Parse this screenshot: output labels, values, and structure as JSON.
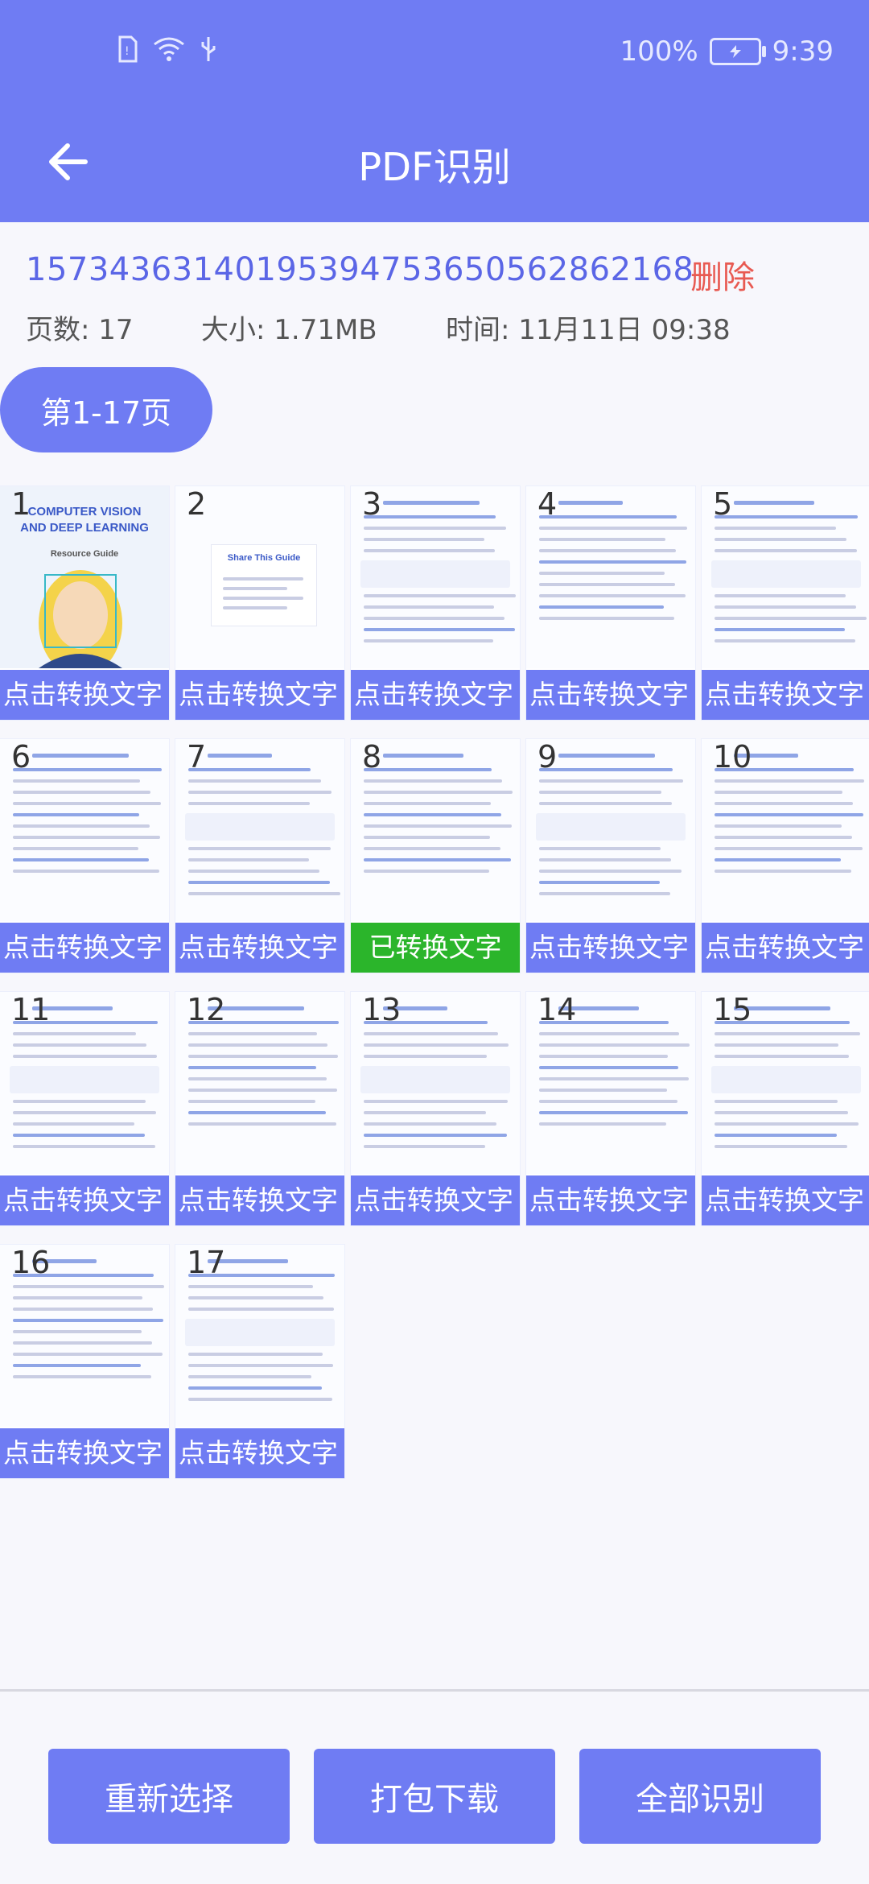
{
  "status_bar": {
    "battery": "100%",
    "time": "9:39"
  },
  "header": {
    "title": "PDF识别"
  },
  "document": {
    "name": "15734363140195394753650562862168",
    "delete_label": "删除",
    "pages_label": "页数: 17",
    "size_label": "大小: 1.71MB",
    "time_label": "时间: 11月11日 09:38"
  },
  "page_range": "第1-17页",
  "pages": [
    {
      "n": "1",
      "caption": "点击转换文字",
      "converted": false,
      "thumb_text": [
        "COMPUTER VISION",
        "AND DEEP LEARNING",
        "Resource Guide"
      ]
    },
    {
      "n": "2",
      "caption": "点击转换文字",
      "converted": false,
      "thumb_text": [
        "Share This Guide"
      ]
    },
    {
      "n": "3",
      "caption": "点击转换文字",
      "converted": false
    },
    {
      "n": "4",
      "caption": "点击转换文字",
      "converted": false
    },
    {
      "n": "5",
      "caption": "点击转换文字",
      "converted": false
    },
    {
      "n": "6",
      "caption": "点击转换文字",
      "converted": false
    },
    {
      "n": "7",
      "caption": "点击转换文字",
      "converted": false
    },
    {
      "n": "8",
      "caption": "已转换文字",
      "converted": true
    },
    {
      "n": "9",
      "caption": "点击转换文字",
      "converted": false
    },
    {
      "n": "10",
      "caption": "点击转换文字",
      "converted": false
    },
    {
      "n": "11",
      "caption": "点击转换文字",
      "converted": false
    },
    {
      "n": "12",
      "caption": "点击转换文字",
      "converted": false
    },
    {
      "n": "13",
      "caption": "点击转换文字",
      "converted": false
    },
    {
      "n": "14",
      "caption": "点击转换文字",
      "converted": false
    },
    {
      "n": "15",
      "caption": "点击转换文字",
      "converted": false
    },
    {
      "n": "16",
      "caption": "点击转换文字",
      "converted": false
    },
    {
      "n": "17",
      "caption": "点击转换文字",
      "converted": false
    }
  ],
  "buttons": {
    "reselect": "重新选择",
    "download": "打包下载",
    "recognize_all": "全部识别"
  },
  "colors": {
    "primary": "#6f7cf3",
    "danger": "#e85a52",
    "success": "#2bb52b"
  }
}
